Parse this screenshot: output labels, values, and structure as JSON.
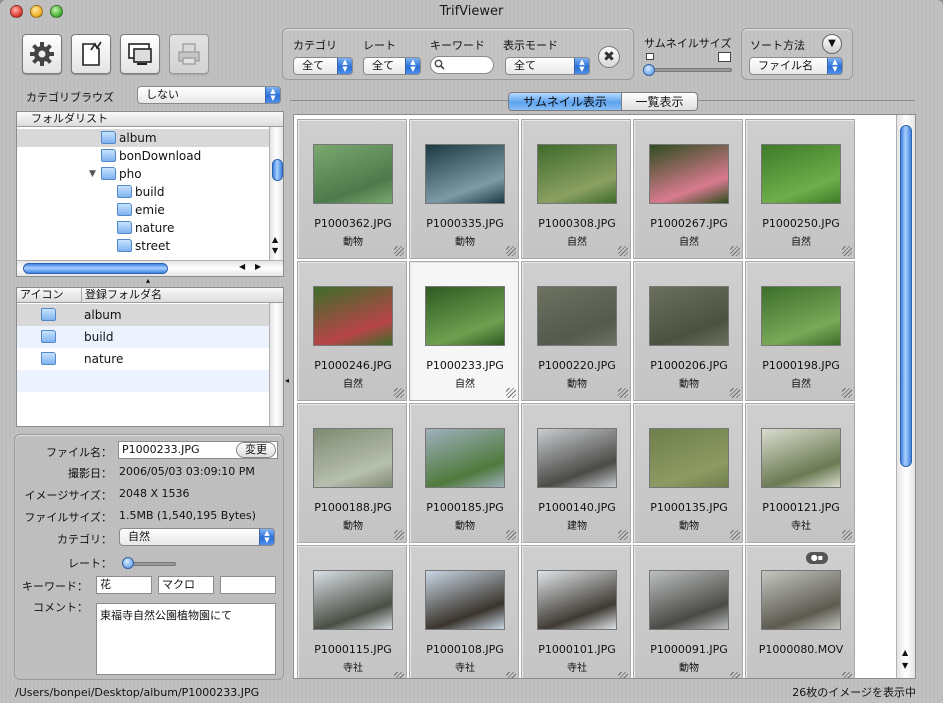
{
  "window": {
    "title": "TrifViewer"
  },
  "toolbar": {
    "buttons": [
      {
        "icon": "gear-icon"
      },
      {
        "icon": "document-edit-icon"
      },
      {
        "icon": "slideshow-icon"
      },
      {
        "icon": "printer-icon",
        "disabled": true
      }
    ]
  },
  "filters": {
    "category_label": "カテゴリ",
    "category_value": "全て",
    "rate_label": "レート",
    "rate_value": "全て",
    "keyword_label": "キーワード",
    "keyword_value": "",
    "display_mode_label": "表示モード",
    "display_mode_value": "全て",
    "thumb_size_label": "サムネイルサイズ",
    "sort_label": "ソート方法",
    "sort_value": "ファイル名"
  },
  "category_browse": {
    "label": "カテゴリブラウズ",
    "value": "しない"
  },
  "folder_list": {
    "header": "フォルダリスト",
    "items": [
      {
        "label": "album",
        "indent": 1,
        "selected": true
      },
      {
        "label": "bonDownload",
        "indent": 1
      },
      {
        "label": "pho",
        "indent": 1,
        "expanded": true
      },
      {
        "label": "build",
        "indent": 2
      },
      {
        "label": "emie",
        "indent": 2
      },
      {
        "label": "nature",
        "indent": 2
      },
      {
        "label": "street",
        "indent": 2
      }
    ]
  },
  "registered": {
    "col_icon": "アイコン",
    "col_folder": "登録フォルダ名",
    "items": [
      {
        "label": "album"
      },
      {
        "label": "build"
      },
      {
        "label": "nature"
      }
    ]
  },
  "info": {
    "filename_label": "ファイル名：",
    "filename_value": "P1000233.JPG",
    "rename_button": "変更",
    "date_label": "撮影日：",
    "date_value": "2006/05/03 03:09:10 PM",
    "imagesize_label": "イメージサイズ：",
    "imagesize_value": "2048 X 1536",
    "filesize_label": "ファイルサイズ：",
    "filesize_value": "1.5MB (1,540,195 Bytes)",
    "category_label": "カテゴリ：",
    "category_value": "自然",
    "rate_label": "レート：",
    "keyword_label": "キーワード：",
    "keywords": [
      "花",
      "マクロ",
      ""
    ],
    "comment_label": "コメント：",
    "comment_value": "東福寺自然公園植物園にて"
  },
  "view_tabs": {
    "thumbnail": "サムネイル表示",
    "list": "一覧表示"
  },
  "thumbnails": [
    {
      "name": "P1000362.JPG",
      "category": "動物",
      "colors": [
        "#7aa870",
        "#4d7a4a"
      ]
    },
    {
      "name": "P1000335.JPG",
      "category": "動物",
      "colors": [
        "#1d3a44",
        "#7d9aa6"
      ]
    },
    {
      "name": "P1000308.JPG",
      "category": "自然",
      "colors": [
        "#3f6b2c",
        "#8aa062"
      ]
    },
    {
      "name": "P1000267.JPG",
      "category": "自然",
      "colors": [
        "#2e4d1f",
        "#d97a8f"
      ]
    },
    {
      "name": "P1000250.JPG",
      "category": "自然",
      "colors": [
        "#3e7a2a",
        "#6fae4a"
      ]
    },
    {
      "name": "P1000246.JPG",
      "category": "自然",
      "colors": [
        "#3c6e2a",
        "#b84448"
      ]
    },
    {
      "name": "P1000233.JPG",
      "category": "自然",
      "colors": [
        "#2f5a22",
        "#6ea050"
      ],
      "selected": true
    },
    {
      "name": "P1000220.JPG",
      "category": "動物",
      "colors": [
        "#6d7262",
        "#545a4c"
      ]
    },
    {
      "name": "P1000206.JPG",
      "category": "動物",
      "colors": [
        "#6a705c",
        "#4c5242"
      ]
    },
    {
      "name": "P1000198.JPG",
      "category": "自然",
      "colors": [
        "#3d6f2b",
        "#79a858"
      ]
    },
    {
      "name": "P1000188.JPG",
      "category": "動物",
      "colors": [
        "#7f8a72",
        "#b7bfae"
      ]
    },
    {
      "name": "P1000185.JPG",
      "category": "動物",
      "colors": [
        "#9fb0bd",
        "#4f7a3c"
      ]
    },
    {
      "name": "P1000140.JPG",
      "category": "建物",
      "colors": [
        "#c7ccd0",
        "#4b4a46"
      ]
    },
    {
      "name": "P1000135.JPG",
      "category": "動物",
      "colors": [
        "#6f7f4c",
        "#8d9a62"
      ]
    },
    {
      "name": "P1000121.JPG",
      "category": "寺社",
      "colors": [
        "#d9dccf",
        "#6b7a52"
      ]
    },
    {
      "name": "P1000115.JPG",
      "category": "寺社",
      "colors": [
        "#d9dfe4",
        "#4a4f45"
      ]
    },
    {
      "name": "P1000108.JPG",
      "category": "寺社",
      "colors": [
        "#c9d7e6",
        "#3a342c"
      ]
    },
    {
      "name": "P1000101.JPG",
      "category": "寺社",
      "colors": [
        "#dfe4e8",
        "#3f3a33"
      ]
    },
    {
      "name": "P1000091.JPG",
      "category": "動物",
      "colors": [
        "#bcc0bf",
        "#4a4a46"
      ]
    },
    {
      "name": "P1000080.MOV",
      "category": "",
      "colors": [
        "#c3c6c0",
        "#5d5a50"
      ],
      "movie": true
    }
  ],
  "status": {
    "path": "/Users/bonpei/Desktop/album/P1000233.JPG",
    "count_text": "26枚のイメージを表示中"
  }
}
